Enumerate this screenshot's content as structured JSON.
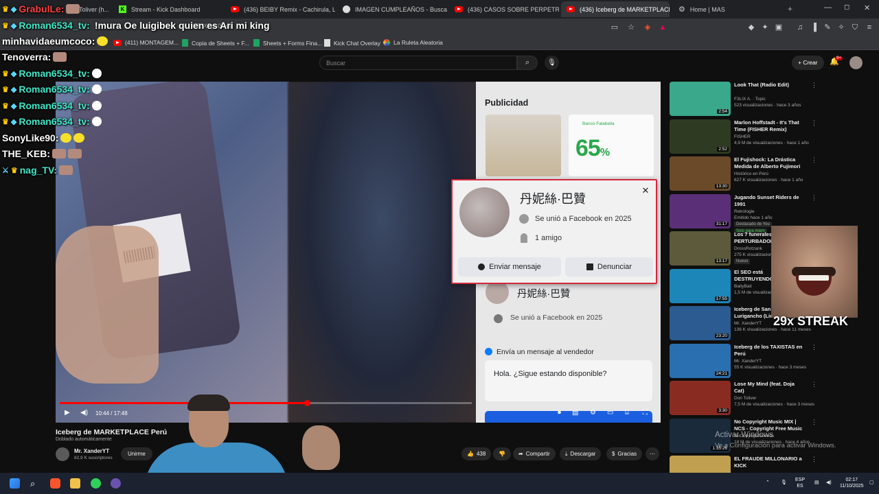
{
  "browser": {
    "tabs": [
      {
        "label": "Toliver (h...",
        "icon": "toliver-thumb",
        "active": false
      },
      {
        "label": "Stream - Kick Dashboard",
        "icon": "kick-icon",
        "active": false
      },
      {
        "label": "(436) BEIBY Remix - Cachirula, Loojan",
        "icon": "youtube-icon",
        "active": false
      },
      {
        "label": "IMAGEN CUMPLEAÑOS - Buscar con",
        "icon": "google-icon",
        "active": false
      },
      {
        "label": "(436) CASOS SOBRE PERPETRADOR",
        "icon": "youtube-icon",
        "active": false
      },
      {
        "label": "(436) Iceberg de MARKETPLACE",
        "icon": "youtube-icon",
        "active": true
      },
      {
        "label": "Home | MAS",
        "icon": "gear-icon",
        "active": false
      }
    ],
    "url": "0B3XZps0cwk",
    "bookmarks": [
      {
        "label": "(411) MONTAGEM...",
        "icon": "youtube-icon"
      },
      {
        "label": "Copia de Sheets + F...",
        "icon": "sheets-icon"
      },
      {
        "label": "Sheets + Forms Fina...",
        "icon": "sheets-icon"
      },
      {
        "label": "Kick Chat Overlay",
        "icon": "file-icon"
      },
      {
        "label": "La Ruleta Aleatoria",
        "icon": "roulette-icon"
      }
    ]
  },
  "youtube": {
    "search_placeholder": "Buscar",
    "create_label": "Crear",
    "notification_count": "9+",
    "video": {
      "title": "Iceberg de MARKETPLACE Perú",
      "dub_note": "Doblado automáticamente",
      "time": "10:44 / 17:48",
      "progress": 0.6,
      "channel_name": "Mr. XanderYT",
      "channel_subs": "82,9 K suscriptores",
      "subscribe_label": "Unirme",
      "likes": "438",
      "share_label": "Compartir",
      "download_label": "Descargar",
      "thanks_label": "Gracias"
    },
    "facebook_frame": {
      "ad_title": "Publicidad",
      "ad_percent": "65",
      "ad_brand": "Banco Falabella",
      "seller_name": "丹妮絲·巴贊",
      "seller_joined": "Se unió a Facebook en 2025",
      "send_label": "Envía un mensaje al vendedor",
      "message": "Hola. ¿Sigue estando disponible?",
      "popup": {
        "name": "丹妮絲·巴贊",
        "joined": "Se unió a Facebook en 2025",
        "friends": "1 amigo",
        "message_btn": "Enviar mensaje",
        "report_btn": "Denunciar"
      }
    },
    "recommendations": [
      {
        "title": "Look That (Radio Edit)",
        "channel": "F3LIX A. · Topic",
        "meta": "523 visualizaciones · hace 3 años",
        "duration": "2:54",
        "thumb_color": "#3aa88b"
      },
      {
        "title": "Marlon Hoffstadt - It's That Time (FISHER Remix)",
        "channel": "FISHER",
        "meta": "4,9 M de visualizaciones · hace 1 año",
        "duration": "2:52",
        "thumb_color": "#2f3a22"
      },
      {
        "title": "El Fujishock: La Drástica Medida de Alberto Fujimori qu...",
        "channel": "Histórico en Perú",
        "meta": "627 K visualizaciones · hace 1 año",
        "duration": "13:30",
        "thumb_color": "#6b4a2a"
      },
      {
        "title": "Jugando Sunset Riders de 1991",
        "channel": "Retrologie",
        "meta": "Emitido hace 1 año",
        "duration": "31:17",
        "thumb_color": "#5a2f78",
        "pills": [
          "Destacado de You",
          "Solo para miem"
        ]
      },
      {
        "title": "Los 7 funerales más PERTURBADORES...",
        "channel": "DrossRotzank",
        "meta": "275 K visualizaciones",
        "duration": "13:17",
        "thumb_color": "#5c5a3a",
        "pills": [
          "Nuevo"
        ]
      },
      {
        "title": "El SEO está DESTRUYENDO contenido en Inter...",
        "channel": "BaityBait",
        "meta": "1,5 M de visualizaciones",
        "duration": "17:55",
        "thumb_color": "#1d86b8"
      },
      {
        "title": "Iceberg de San Juan de Lurigancho (Lima - Perú)",
        "channel": "Mr. XanderYT",
        "meta": "136 K visualizaciones · hace 11 meses",
        "duration": "23:20",
        "thumb_color": "#2b5b90"
      },
      {
        "title": "Iceberg de los TAXISTAS en Perú",
        "channel": "Mr. XanderYT",
        "meta": "55 K visualizaciones · hace 3 meses",
        "duration": "24:21",
        "thumb_color": "#2a6fb0"
      },
      {
        "title": "Lose My Mind (feat. Doja Cat)",
        "channel": "Don Toliver",
        "meta": "7,5 M de visualizaciones · hace 3 meses",
        "duration": "3:30",
        "thumb_color": "#8a2b22"
      },
      {
        "title": "No Copyright Music MIX | NCS - Copyright Free Music",
        "channel": "NoCopyrightSounds",
        "meta": "18 M de visualizaciones · hace 4 años",
        "duration": "1:35:26",
        "thumb_color": "#1a2a3a"
      },
      {
        "title": "EL FRAUDE MILLONARIO a KICK",
        "channel": "",
        "meta": "",
        "duration": "",
        "thumb_color": "#c0a050"
      }
    ]
  },
  "chat": [
    {
      "user": "GrabulLe:",
      "message": "",
      "color": "#ff4040",
      "badges": "crown-dia",
      "emote": "emote-image"
    },
    {
      "user": "Roman6534_tv:",
      "message": "!mura Oe luigibek quien es Ari mi king",
      "color": "#3fe8c8",
      "badges": "crown-dia"
    },
    {
      "user": "minhavidaeumcoco:",
      "message": "",
      "color": "#ffffff",
      "badges": "",
      "emote": "emote-yellow"
    },
    {
      "user": "Tenoverra:",
      "message": "",
      "color": "#ffffff",
      "badges": "",
      "emote": "emote-image"
    },
    {
      "user": "Roman6534_tv:",
      "message": "",
      "color": "#3fe8c8",
      "badges": "crown-dia",
      "emote": "emote-bubble"
    },
    {
      "user": "Roman6534_tv:",
      "message": "",
      "color": "#3fe8c8",
      "badges": "crown-dia",
      "emote": "emote-bubble"
    },
    {
      "user": "Roman6534_tv:",
      "message": "",
      "color": "#3fe8c8",
      "badges": "crown-dia",
      "emote": "emote-bubble"
    },
    {
      "user": "Roman6534_tv:",
      "message": "",
      "color": "#3fe8c8",
      "badges": "crown-dia",
      "emote": "emote-bubble"
    },
    {
      "user": "SonyLike90:",
      "message": "",
      "color": "#ffffff",
      "badges": "",
      "emote": "emote-yellow2"
    },
    {
      "user": "THE_KEB:",
      "message": "",
      "color": "#ffffff",
      "badges": "",
      "emote": "emote-image2"
    },
    {
      "user": "nag_TV:",
      "message": "",
      "color": "#3fe8c8",
      "badges": "sword-crown",
      "emote": "emote-image"
    }
  ],
  "overlay": {
    "streak": "29x STREAK"
  },
  "windows": {
    "watermark_title": "Activar Windows",
    "watermark_sub": "Ve a Configuración para activar Windows.",
    "lang_top": "ESP",
    "lang_bottom": "ES",
    "time": "02:17",
    "date": "11/10/2025"
  }
}
